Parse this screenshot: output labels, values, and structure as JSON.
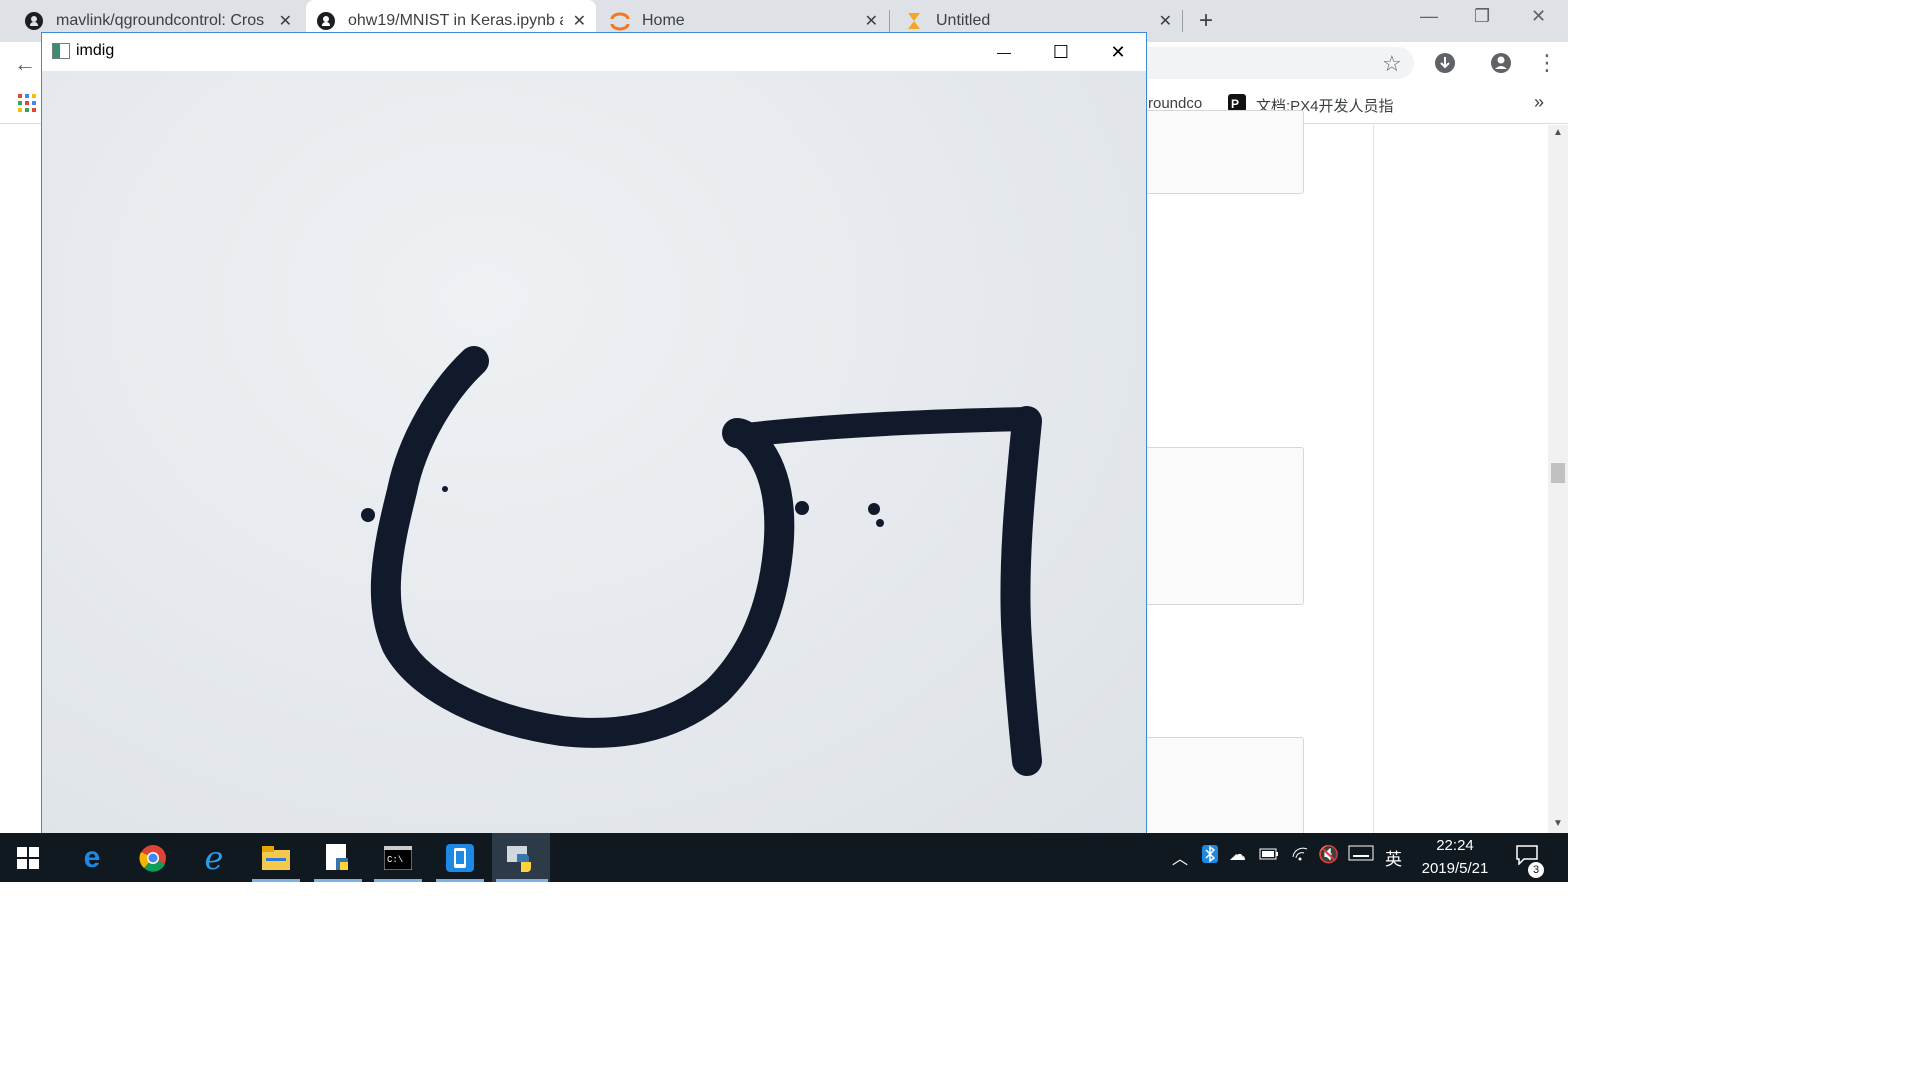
{
  "browser": {
    "tabs": [
      {
        "title": "mavlink/qgroundcontrol: Cros",
        "icon": "github-icon"
      },
      {
        "title": "ohw19/MNIST in Keras.ipynb a",
        "icon": "github-icon"
      },
      {
        "title": "Home",
        "icon": "jupyter-icon"
      },
      {
        "title": "Untitled",
        "icon": "hourglass-icon"
      }
    ],
    "close_glyph": "✕",
    "new_tab_glyph": "+",
    "bookmarks": [
      {
        "label": "roundco"
      },
      {
        "label": "文档:PX4开发人员指"
      }
    ],
    "overflow_glyph": "»"
  },
  "window": {
    "title": "imdig",
    "minimize_glyph": "—",
    "maximize_glyph": "☐",
    "close_glyph": "✕"
  },
  "colors": {
    "ink": "#111a2b",
    "accent": "#3c8bd6",
    "taskbar": "#101820"
  },
  "taskbar": {
    "apps": [
      "windows-start-icon",
      "edge-icon",
      "chrome-icon",
      "ie-icon",
      "file-explorer-icon",
      "python-file-icon",
      "terminal-icon",
      "phone-icon",
      "python-icon"
    ],
    "tray": {
      "ime": "英",
      "time": "22:24",
      "date": "2019/5/21",
      "notification_count": "3"
    }
  }
}
